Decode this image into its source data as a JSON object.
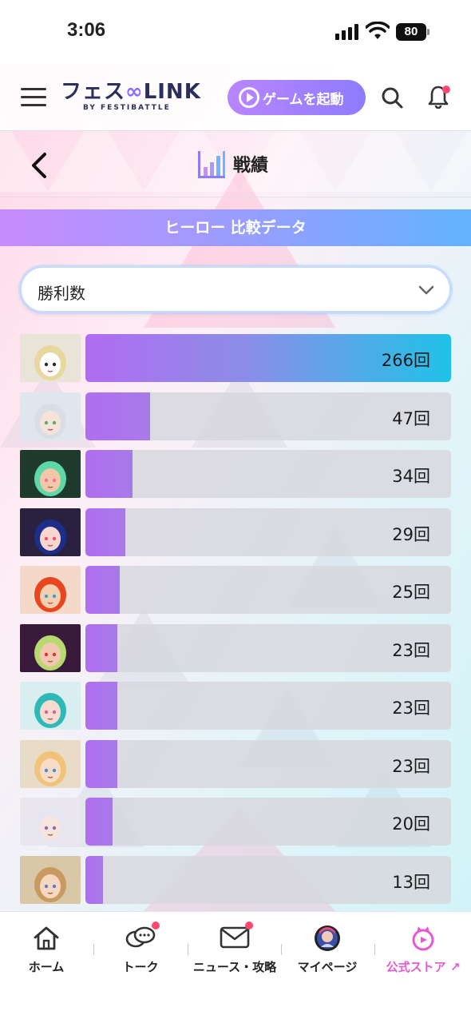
{
  "status_bar": {
    "time": "3:06",
    "battery": "80"
  },
  "header": {
    "logo_text": "フェス",
    "logo_link": "LINK",
    "logo_sub": "BY FESTIBATTLE",
    "launch_button": "ゲームを起動"
  },
  "title_bar": {
    "title": "戦績"
  },
  "section": {
    "banner": "ヒーロー 比較データ"
  },
  "dropdown": {
    "selected": "勝利数"
  },
  "colors": {
    "accent_purple": "#b06ef0",
    "accent_cyan": "#1fc2e8",
    "store_pink": "#e45ad2",
    "badge_red": "#ff4a6e"
  },
  "heroes": [
    {
      "value": 266,
      "label": "266回",
      "avatar": "cat-hero"
    },
    {
      "value": 47,
      "label": "47回",
      "avatar": "silver-hair-hero"
    },
    {
      "value": 34,
      "label": "34回",
      "avatar": "green-hair-hero"
    },
    {
      "value": 29,
      "label": "29回",
      "avatar": "navy-hair-hero"
    },
    {
      "value": 25,
      "label": "25回",
      "avatar": "red-hair-hero"
    },
    {
      "value": 23,
      "label": "23回",
      "avatar": "lime-hair-hero"
    },
    {
      "value": 23,
      "label": "23回",
      "avatar": "teal-twintail-hero"
    },
    {
      "value": 23,
      "label": "23回",
      "avatar": "blonde-hero"
    },
    {
      "value": 20,
      "label": "20回",
      "avatar": "white-hair-hero"
    },
    {
      "value": 13,
      "label": "13回",
      "avatar": "brown-hair-hero"
    }
  ],
  "bottom_nav": [
    {
      "label": "ホーム",
      "icon": "home-icon"
    },
    {
      "label": "トーク",
      "icon": "chat-icon"
    },
    {
      "label": "ニュース・攻略",
      "icon": "mail-icon"
    },
    {
      "label": "マイページ",
      "icon": "avatar-icon"
    },
    {
      "label": "公式ストア",
      "icon": "store-icon"
    }
  ]
}
